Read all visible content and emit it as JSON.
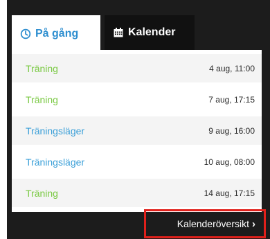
{
  "tabs": [
    {
      "label": "På gång",
      "icon": "clock-icon",
      "active": true
    },
    {
      "label": "Kalender",
      "icon": "calendar-icon",
      "active": false
    }
  ],
  "events": [
    {
      "title": "Träning",
      "when": "4 aug, 11:00",
      "color": "#7ac943"
    },
    {
      "title": "Träning",
      "when": "7 aug, 17:15",
      "color": "#7ac943"
    },
    {
      "title": "Träningsläger",
      "when": "9 aug, 16:00",
      "color": "#3a9fd8"
    },
    {
      "title": "Träningsläger",
      "when": "10 aug, 08:00",
      "color": "#3a9fd8"
    },
    {
      "title": "Träning",
      "when": "14 aug, 17:15",
      "color": "#7ac943"
    }
  ],
  "footer": {
    "link_label": "Kalenderöversikt",
    "icon": "chevron-right-icon"
  },
  "colors": {
    "accent_blue": "#2f8fd0",
    "highlight_border": "#e0201b",
    "dark_bg": "#1c1c1c"
  }
}
